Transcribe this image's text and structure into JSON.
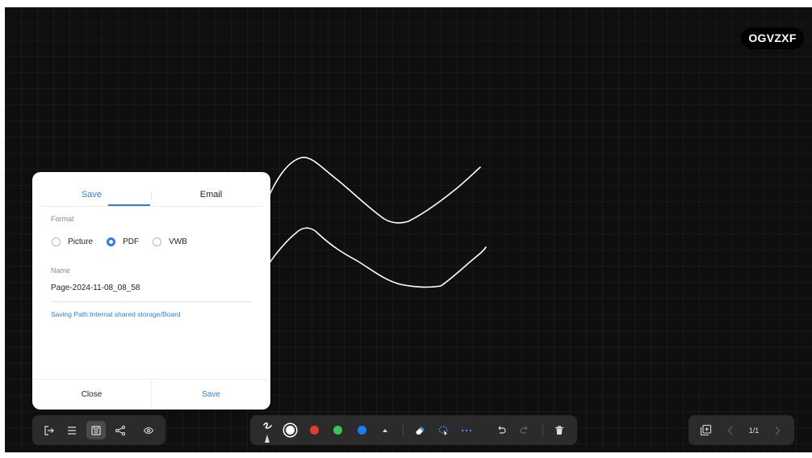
{
  "board": {
    "code": "OGVZXF",
    "background": "#0f0f0f",
    "stroke_color": "#ffffff"
  },
  "dialog": {
    "tabs": [
      {
        "label": "Save",
        "active": true
      },
      {
        "label": "Email",
        "active": false
      }
    ],
    "format_label": "Format",
    "format_options": [
      {
        "label": "Picture",
        "checked": false
      },
      {
        "label": "PDF",
        "checked": true
      },
      {
        "label": "VWB",
        "checked": false
      }
    ],
    "name_label": "Name",
    "name_value": "Page-2024-11-08_08_58",
    "saving_path": "Saving Path:Internal shared storage/Board",
    "close_label": "Close",
    "save_label": "Save",
    "accent_color": "#2f7fe0"
  },
  "left_toolbar": {
    "icons": [
      "exit-icon",
      "menu-icon",
      "save-icon",
      "share-icon",
      "eye-icon"
    ]
  },
  "center_toolbar": {
    "icons": [
      "pen-icon",
      "white-color",
      "red-color",
      "green-color",
      "blue-color",
      "expand-up-icon",
      "eraser-icon",
      "lasso-select-icon",
      "more-icon",
      "undo-icon",
      "redo-icon",
      "trash-icon"
    ],
    "colors": {
      "white": "#ffffff",
      "red": "#e53935",
      "green": "#34c759",
      "blue": "#1e7cf0"
    }
  },
  "right_toolbar": {
    "page_indicator": "1/1",
    "icons": [
      "add-page-icon",
      "prev-page-icon",
      "next-page-icon"
    ]
  }
}
